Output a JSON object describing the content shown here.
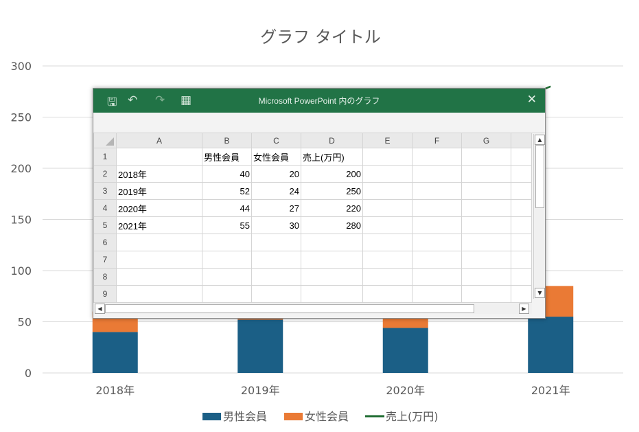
{
  "chart_data": {
    "type": "bar",
    "stacked": true,
    "title": "グラフ タイトル",
    "categories": [
      "2018年",
      "2019年",
      "2020年",
      "2021年"
    ],
    "series": [
      {
        "name": "男性会員",
        "type": "bar",
        "color": "#1b5f86",
        "values": [
          40,
          52,
          44,
          55
        ]
      },
      {
        "name": "女性会員",
        "type": "bar",
        "color": "#ea7a35",
        "values": [
          20,
          24,
          27,
          30
        ]
      },
      {
        "name": "売上(万円)",
        "type": "line",
        "color": "#1e6b30",
        "values": [
          200,
          250,
          220,
          280
        ]
      }
    ],
    "ylim": [
      0,
      300
    ],
    "yticks": [
      "0",
      "50",
      "100",
      "150",
      "200",
      "250",
      "300"
    ],
    "grid": true,
    "legend": "bottom"
  },
  "excel": {
    "window_title": "Microsoft PowerPoint 内のグラフ",
    "icons": {
      "save": "save-icon",
      "undo": "undo-icon",
      "redo": "redo-icon",
      "table": "table-icon",
      "close": "close-icon"
    },
    "save_glyph": "🖫",
    "undo_glyph": "↶",
    "redo_glyph": "↷",
    "table_glyph": "▦",
    "close_glyph": "✕",
    "column_headers": [
      "A",
      "B",
      "C",
      "D",
      "E",
      "F",
      "G"
    ],
    "row_numbers": [
      "1",
      "2",
      "3",
      "4",
      "5",
      "6",
      "7",
      "8",
      "9"
    ],
    "cells": [
      [
        "",
        "男性会員",
        "女性会員",
        "売上(万円)",
        "",
        "",
        ""
      ],
      [
        "2018年",
        "40",
        "20",
        "200",
        "",
        "",
        ""
      ],
      [
        "2019年",
        "52",
        "24",
        "250",
        "",
        "",
        ""
      ],
      [
        "2020年",
        "44",
        "27",
        "220",
        "",
        "",
        ""
      ],
      [
        "2021年",
        "55",
        "30",
        "280",
        "",
        "",
        ""
      ],
      [
        "",
        "",
        "",
        "",
        "",
        "",
        ""
      ],
      [
        "",
        "",
        "",
        "",
        "",
        "",
        ""
      ],
      [
        "",
        "",
        "",
        "",
        "",
        "",
        ""
      ],
      [
        "",
        "",
        "",
        "",
        "",
        "",
        ""
      ]
    ]
  }
}
